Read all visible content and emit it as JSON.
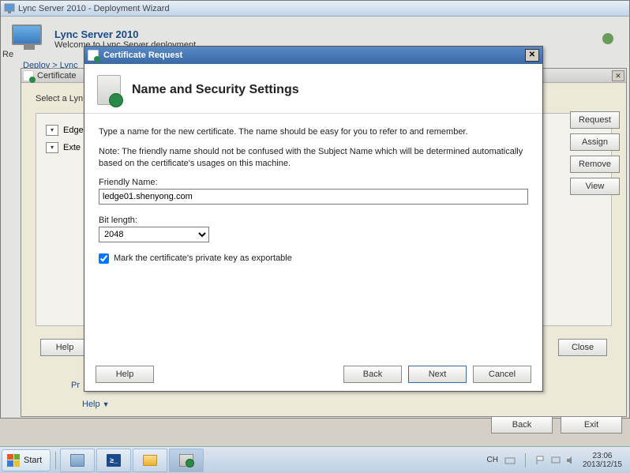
{
  "bg_window": {
    "title": "Lync Server 2010 - Deployment Wizard",
    "heading": "Lync Server 2010",
    "subheading": "Welcome to Lync Server deployment.",
    "breadcrumb_a": "Deploy",
    "breadcrumb_sep": " > ",
    "breadcrumb_b": "Lync",
    "re_text": "Re",
    "help_button": "Help",
    "close_button": "Close",
    "help_link": "Help",
    "back_button": "Back",
    "exit_button": "Exit"
  },
  "cert_wizard": {
    "title": "Certificate",
    "select_label": "Select a Lyn",
    "exp1": "Edge",
    "exp2": "Exte",
    "request_button": "Request",
    "assign_button": "Assign",
    "remove_button": "Remove",
    "view_button": "View",
    "prev_link": "Pr"
  },
  "modal": {
    "title": "Certificate Request",
    "heading": "Name and Security Settings",
    "intro": "Type a name for the new certificate. The name should be easy for you to refer to and remember.",
    "note": "Note: The friendly name should not be confused with the Subject Name which will be determined automatically based on the certificate's usages on this machine.",
    "friendly_name_label": "Friendly Name:",
    "friendly_name_value": "ledge01.shenyong.com",
    "bit_length_label": "Bit length:",
    "bit_length_value": "2048",
    "checkbox_label": "Mark the certificate's private key as exportable",
    "checkbox_checked": true,
    "help_button": "Help",
    "back_button": "Back",
    "next_button": "Next",
    "cancel_button": "Cancel"
  },
  "taskbar": {
    "start": "Start",
    "ime": "CH",
    "clock_time": "23:06",
    "clock_date": "2013/12/15"
  }
}
